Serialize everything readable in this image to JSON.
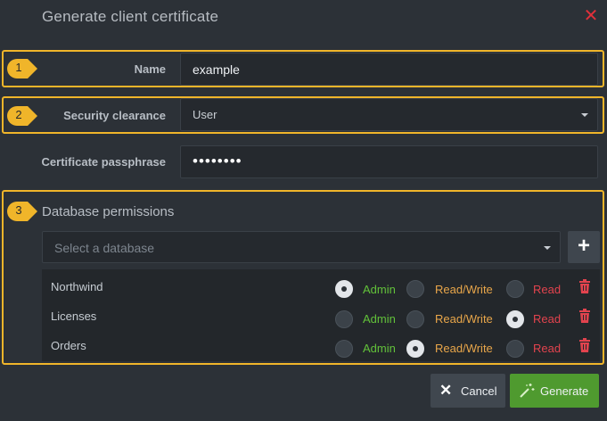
{
  "dialog": {
    "title": "Generate client certificate"
  },
  "callouts": [
    "1",
    "2",
    "3"
  ],
  "form": {
    "name_label": "Name",
    "name_value": "example",
    "security_label": "Security clearance",
    "security_value": "User",
    "passphrase_label": "Certificate passphrase",
    "passphrase_value": "••••••••"
  },
  "permissions": {
    "section_title": "Database permissions",
    "db_placeholder": "Select a database",
    "add_label": "+",
    "options": [
      "Admin",
      "Read/Write",
      "Read"
    ],
    "rows": [
      {
        "name": "Northwind",
        "selected": "Admin"
      },
      {
        "name": "Licenses",
        "selected": "Read"
      },
      {
        "name": "Orders",
        "selected": "Read/Write"
      }
    ]
  },
  "buttons": {
    "cancel_label": "Cancel",
    "generate_label": "Generate"
  },
  "colors": {
    "highlight": "#f0b52a",
    "admin": "#62c23a",
    "read_write": "#e8a64a",
    "read": "#e2434e",
    "generate": "#4f9a2f"
  },
  "icons": [
    "close-icon",
    "chevron-down-icon",
    "plus-icon",
    "trash-icon",
    "magic-wand-icon"
  ]
}
